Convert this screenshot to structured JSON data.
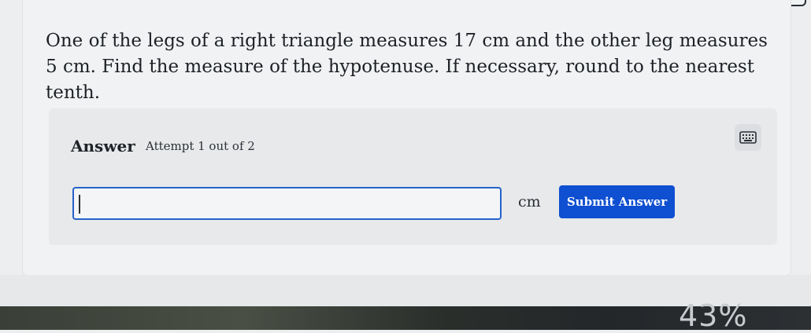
{
  "question": {
    "text": "One of the legs of a right triangle measures 17 cm and the other leg measures 5 cm. Find the measure of the hypotenuse. If necessary, round to the nearest tenth."
  },
  "answer": {
    "title": "Answer",
    "attempt": "Attempt 1 out of 2",
    "input_value": "",
    "unit": "cm",
    "submit_label": "Submit Answer",
    "keyboard_icon": "keyboard-icon"
  },
  "status": {
    "battery": "43%"
  },
  "colors": {
    "accent": "#0f4fd1",
    "input_border": "#2563c9"
  }
}
